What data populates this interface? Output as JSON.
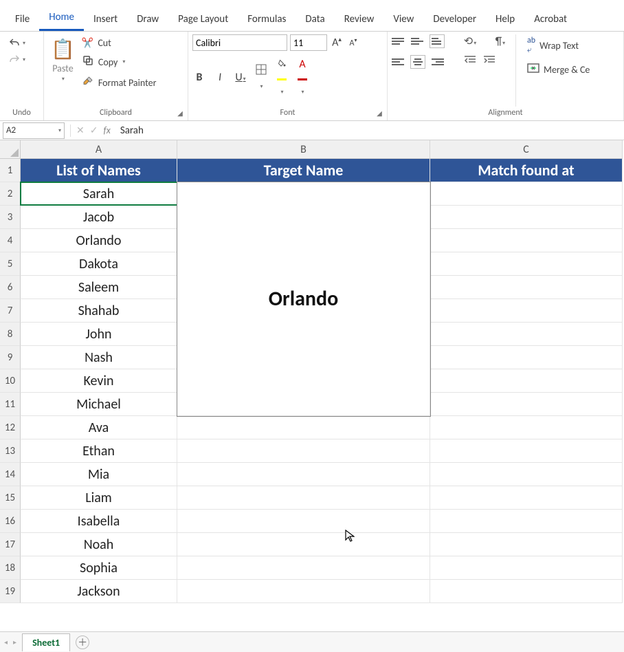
{
  "tabs": {
    "file": "File",
    "home": "Home",
    "insert": "Insert",
    "draw": "Draw",
    "page_layout": "Page Layout",
    "formulas": "Formulas",
    "data": "Data",
    "review": "Review",
    "view": "View",
    "developer": "Developer",
    "help": "Help",
    "acrobat": "Acrobat"
  },
  "ribbon": {
    "undo_group": "Undo",
    "clipboard": {
      "label": "Clipboard",
      "paste": "Paste",
      "cut": "Cut",
      "copy": "Copy",
      "format_painter": "Format Painter"
    },
    "font": {
      "label": "Font",
      "name": "Calibri",
      "size": "11"
    },
    "alignment": {
      "label": "Alignment",
      "wrap": "Wrap Text",
      "merge": "Merge & Ce"
    }
  },
  "formula_bar": {
    "name_box": "A2",
    "formula": "Sarah"
  },
  "columns": {
    "A": "A",
    "B": "B",
    "C": "C"
  },
  "headers": {
    "A": "List of Names",
    "B": "Target Name",
    "C": "Match found at"
  },
  "target_value": "Orlando",
  "names": [
    "Sarah",
    "Jacob",
    "Orlando",
    "Dakota",
    "Saleem",
    "Shahab",
    "John",
    "Nash",
    "Kevin",
    "Michael",
    "Ava",
    "Ethan",
    "Mia",
    "Liam",
    "Isabella",
    "Noah",
    "Sophia",
    "Jackson"
  ],
  "row_numbers": [
    "1",
    "2",
    "3",
    "4",
    "5",
    "6",
    "7",
    "8",
    "9",
    "10",
    "11",
    "12",
    "13",
    "14",
    "15",
    "16",
    "17",
    "18",
    "19"
  ],
  "sheet": {
    "name": "Sheet1"
  }
}
